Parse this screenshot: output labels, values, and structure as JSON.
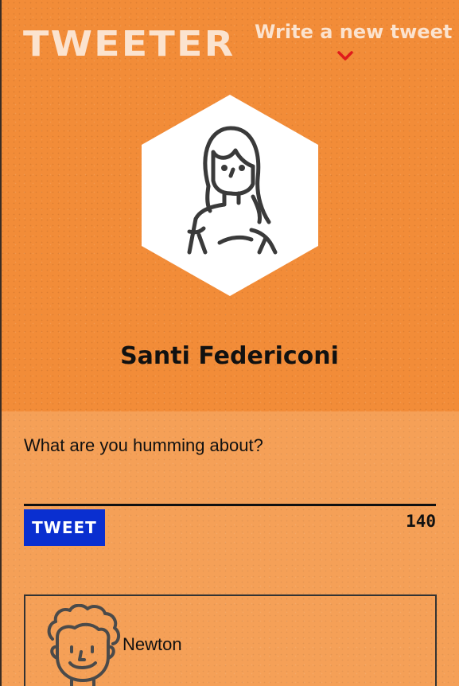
{
  "nav": {
    "logo": "TWEETER",
    "write_link": "Write a new tweet",
    "chevron_icon": "chevron-down-icon"
  },
  "profile": {
    "avatar_icon": "woman-avatar-icon",
    "name": "Santi Federiconi"
  },
  "compose": {
    "placeholder": "What are you humming about?",
    "tweet_button": "TWEET",
    "char_count": "140"
  },
  "tweets": [
    {
      "avatar_icon": "curly-hair-man-avatar-icon",
      "name": "Newton"
    }
  ],
  "colors": {
    "background": "#f28c38",
    "logo_text": "#fbe3cf",
    "chevron": "#e01b1b",
    "tweet_button": "#0a2fd0",
    "text": "#111111"
  }
}
